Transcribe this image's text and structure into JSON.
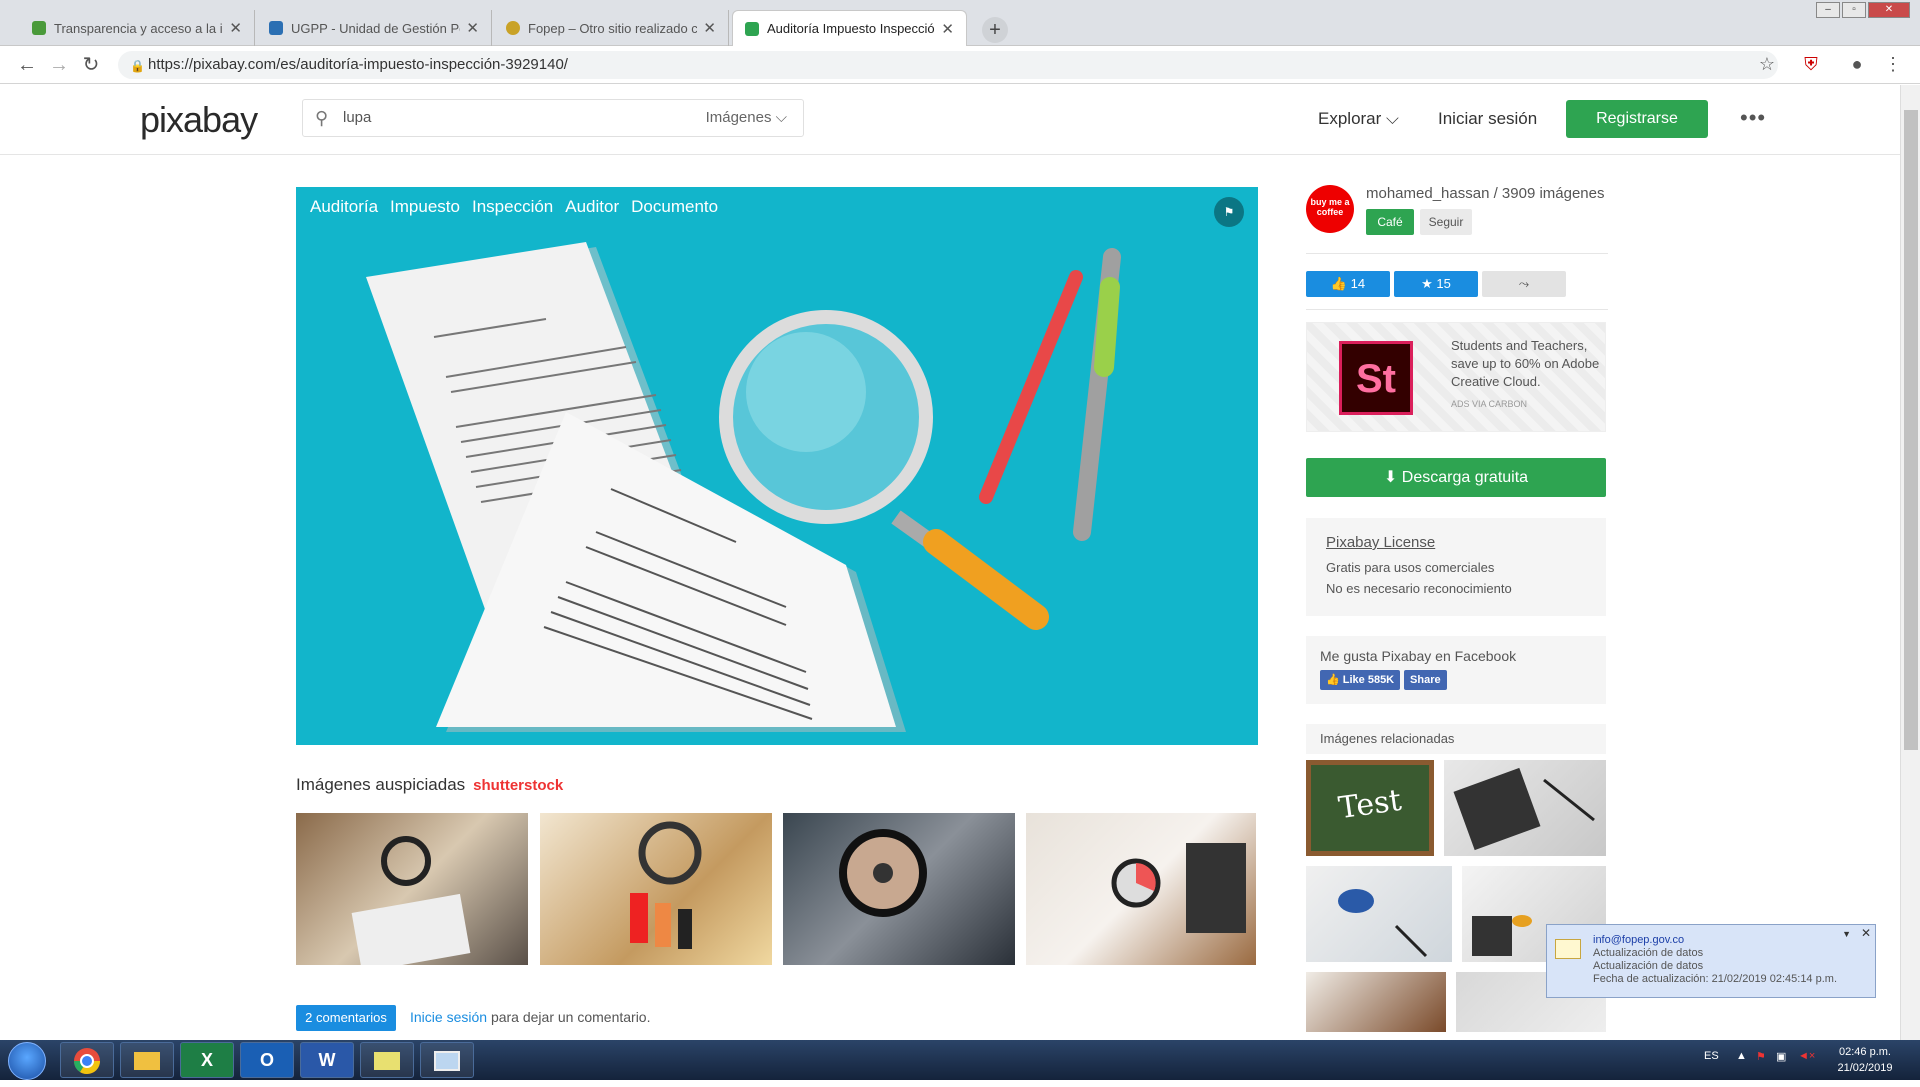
{
  "browser": {
    "tabs": [
      {
        "title": "Transparencia y acceso a la infor",
        "favicon_color": "#4a9a3a"
      },
      {
        "title": "UGPP - Unidad de Gestión Pensi",
        "favicon_color": "#2b6fb3"
      },
      {
        "title": "Fopep – Otro sitio realizado con",
        "favicon_color": "#c9a227"
      },
      {
        "title": "Auditoría Impuesto Inspección - ",
        "favicon_color": "#2ea451"
      }
    ],
    "url": "https://pixabay.com/es/auditoría-impuesto-inspección-3929140/"
  },
  "header": {
    "logo": "pixabay",
    "search_value": "lupa",
    "search_type": "Imágenes",
    "explore": "Explorar",
    "login": "Iniciar sesión",
    "register": "Registrarse"
  },
  "image": {
    "tags": [
      "Auditoría",
      "Impuesto",
      "Inspección",
      "Auditor",
      "Documento"
    ]
  },
  "sponsored": {
    "title": "Imágenes auspiciadas",
    "provider": "shutterstock"
  },
  "comments": {
    "count_label": "2 comentarios",
    "login_link": "Inicie sesión",
    "suffix": "para dejar un comentario."
  },
  "author": {
    "avatar_text": "buy me a coffee",
    "name_line": "mohamed_hassan / 3909 imágenes",
    "cafe": "Café",
    "follow": "Seguir"
  },
  "actions": {
    "likes": "14",
    "favorites": "15"
  },
  "ad": {
    "logo": "St",
    "text": "Students and Teachers, save up to 60% on Adobe Creative Cloud.",
    "via": "ADS VIA CARBON"
  },
  "download": "Descarga gratuita",
  "license": {
    "title": "Pixabay License",
    "line1": "Gratis para usos comerciales",
    "line2": "No es necesario reconocimiento"
  },
  "facebook": {
    "text": "Me gusta Pixabay en Facebook",
    "like": "Like 585K",
    "share": "Share"
  },
  "related": {
    "title": "Imágenes relacionadas",
    "test_label": "Test"
  },
  "notification": {
    "from": "info@fopep.gov.co",
    "line1": "Actualización de datos",
    "line2": "Actualización de datos",
    "line3": "Fecha de actualización: 21/02/2019 02:45:14 p.m."
  },
  "taskbar": {
    "lang": "ES",
    "time": "02:46 p.m.",
    "date": "21/02/2019"
  },
  "colors": {
    "accent": "#2ea451",
    "hero_bg": "#12b5cb",
    "blue": "#1a8de0"
  }
}
